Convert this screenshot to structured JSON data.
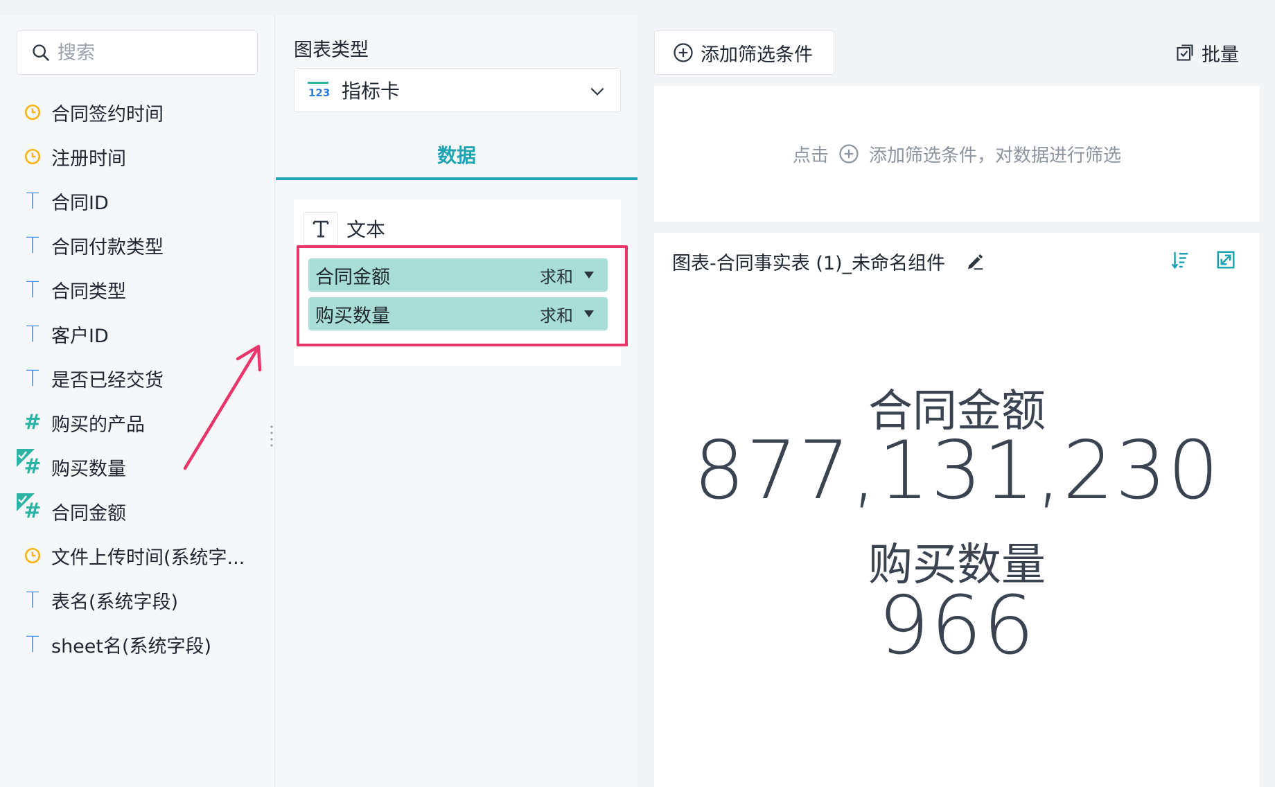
{
  "search": {
    "placeholder": "搜索"
  },
  "fields": [
    {
      "label": "合同签约时间",
      "type": "date",
      "icon": "clock-icon"
    },
    {
      "label": "注册时间",
      "type": "date",
      "icon": "clock-icon"
    },
    {
      "label": "合同ID",
      "type": "text",
      "icon": "text-type-icon",
      "glyph": "T"
    },
    {
      "label": "合同付款类型",
      "type": "text",
      "icon": "text-type-icon",
      "glyph": "T"
    },
    {
      "label": "合同类型",
      "type": "text",
      "icon": "text-type-icon",
      "glyph": "T"
    },
    {
      "label": "客户ID",
      "type": "text",
      "icon": "text-type-icon",
      "glyph": "T"
    },
    {
      "label": "是否已经交货",
      "type": "text",
      "icon": "text-type-icon",
      "glyph": "T"
    },
    {
      "label": "购买的产品",
      "type": "number",
      "icon": "number-type-icon",
      "glyph": "#"
    },
    {
      "label": "购买数量",
      "type": "number",
      "icon": "number-type-icon",
      "glyph": "#",
      "checked": true
    },
    {
      "label": "合同金额",
      "type": "number",
      "icon": "number-type-icon",
      "glyph": "#",
      "checked": true
    },
    {
      "label": "文件上传时间(系统字...",
      "type": "date",
      "icon": "clock-icon"
    },
    {
      "label": "表名(系统字段)",
      "type": "text",
      "icon": "text-type-icon",
      "glyph": "T"
    },
    {
      "label": "sheet名(系统字段)",
      "type": "text",
      "icon": "text-type-icon",
      "glyph": "T"
    }
  ],
  "config": {
    "chart_type_title": "图表类型",
    "chart_type_value": "指标卡",
    "tab_label": "数据",
    "mark_label": "文本",
    "pills": [
      {
        "name": "合同金额",
        "agg": "求和"
      },
      {
        "name": "购买数量",
        "agg": "求和"
      }
    ]
  },
  "filters": {
    "add_label": "添加筛选条件",
    "batch_label": "批量",
    "hint_prefix": "点击",
    "hint_suffix": "添加筛选条件，对数据进行筛选"
  },
  "card": {
    "title": "图表-合同事实表 (1)_未命名组件",
    "metrics": [
      {
        "label": "合同金额",
        "value": "877,131,230"
      },
      {
        "label": "购买数量",
        "value": "966"
      }
    ]
  },
  "colors": {
    "accent": "#1da4b2",
    "date_icon": "#f5b312",
    "text_icon": "#4a90e2",
    "number_icon": "#2bb3a6",
    "pill": "#a9ded6",
    "annotation": "#e8366b"
  }
}
